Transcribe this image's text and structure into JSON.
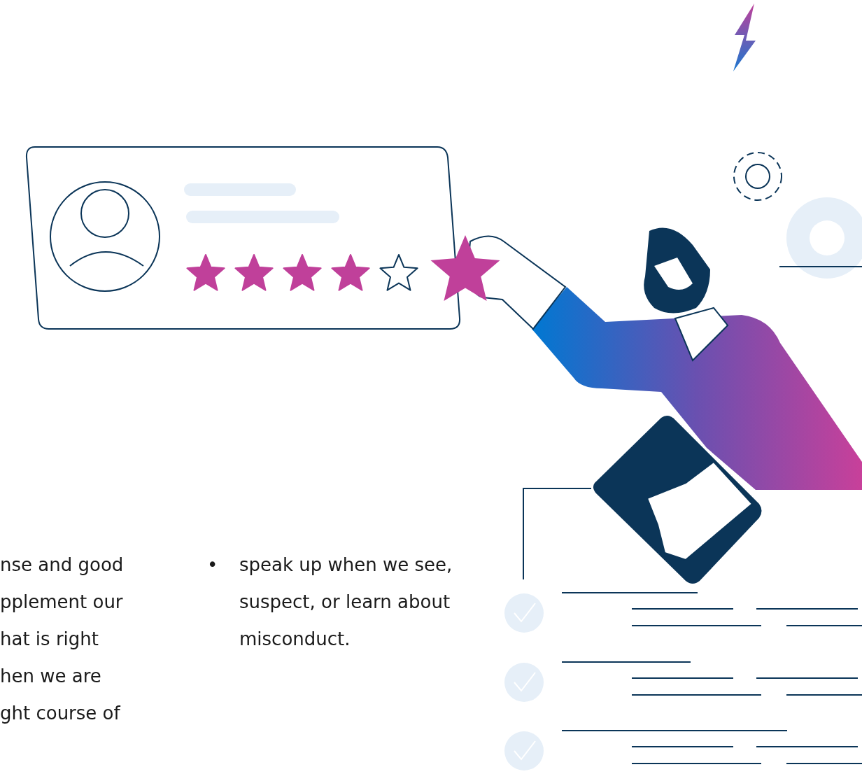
{
  "review_card": {
    "stars": 4
  },
  "left_column_lines": [
    "nse and good",
    "pplement our",
    "hat is right",
    "hen we are",
    "ght course of"
  ],
  "bullets": [
    {
      "marker": "•",
      "text": "speak up when we see, suspect, or learn about misconduct."
    }
  ]
}
